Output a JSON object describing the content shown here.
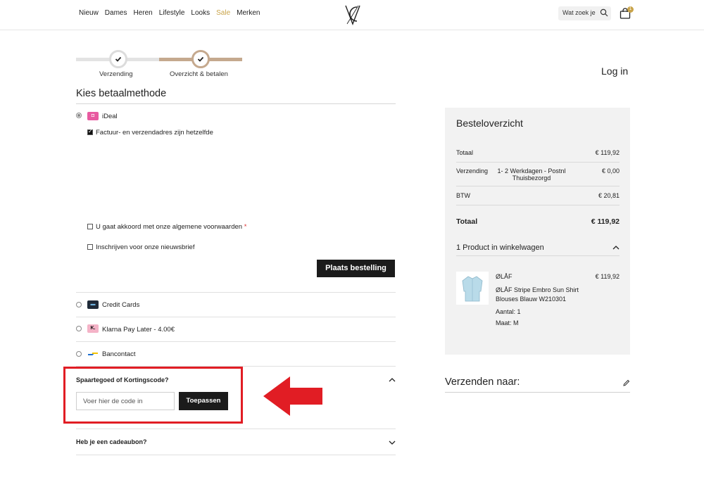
{
  "nav": [
    "Nieuw",
    "Dames",
    "Heren",
    "Lifestyle",
    "Looks",
    "Sale",
    "Merken"
  ],
  "search": {
    "placeholder": "Wat zoek je"
  },
  "cart": {
    "count": "1"
  },
  "steps": [
    {
      "label": "Verzending"
    },
    {
      "label": "Overzicht & betalen"
    }
  ],
  "login": "Log in",
  "payment": {
    "title": "Kies betaalmethode",
    "ideal": "iDeal",
    "same_address": "Factuur- en verzendadres zijn hetzelfde",
    "terms": "U gaat akkoord met onze algemene voorwaarden",
    "terms_required": "*",
    "newsletter": "Inschrijven voor onze nieuwsbrief",
    "place_order": "Plaats bestelling",
    "methods": [
      "Credit Cards",
      "Klarna Pay Later - 4.00€",
      "Bancontact"
    ],
    "klarna_icon": "K."
  },
  "coupon": {
    "title": "Spaartegoed of Kortingscode?",
    "placeholder": "Voer hier de code in",
    "apply": "Toepassen"
  },
  "giftcard": {
    "title": "Heb je een cadeaubon?"
  },
  "summary": {
    "title": "Besteloverzicht",
    "subtotal_label": "Totaal",
    "subtotal_value": "€ 119,92",
    "shipping_label": "Verzending",
    "shipping_method_line1": "1- 2 Werkdagen - Postnl",
    "shipping_method_line2": "Thuisbezorgd",
    "shipping_value": "€ 0,00",
    "tax_label": "BTW",
    "tax_value": "€ 20,81",
    "total_label": "Totaal",
    "total_value": "€ 119,92",
    "cart_heading": "1 Product in winkelwagen",
    "product": {
      "brand": "ØLÅF",
      "price": "€ 119,92",
      "name_line1": "ØLÅF Stripe Embro Sun Shirt",
      "name_line2": "Blouses Blauw W210301",
      "qty": "Aantal: 1",
      "size": "Maat: M"
    }
  },
  "ship_to": {
    "title": "Verzenden naar:"
  },
  "colors": {
    "accent_gold": "#c9a44a",
    "step_active": "#c5a98e",
    "highlight_red": "#e11d24"
  }
}
